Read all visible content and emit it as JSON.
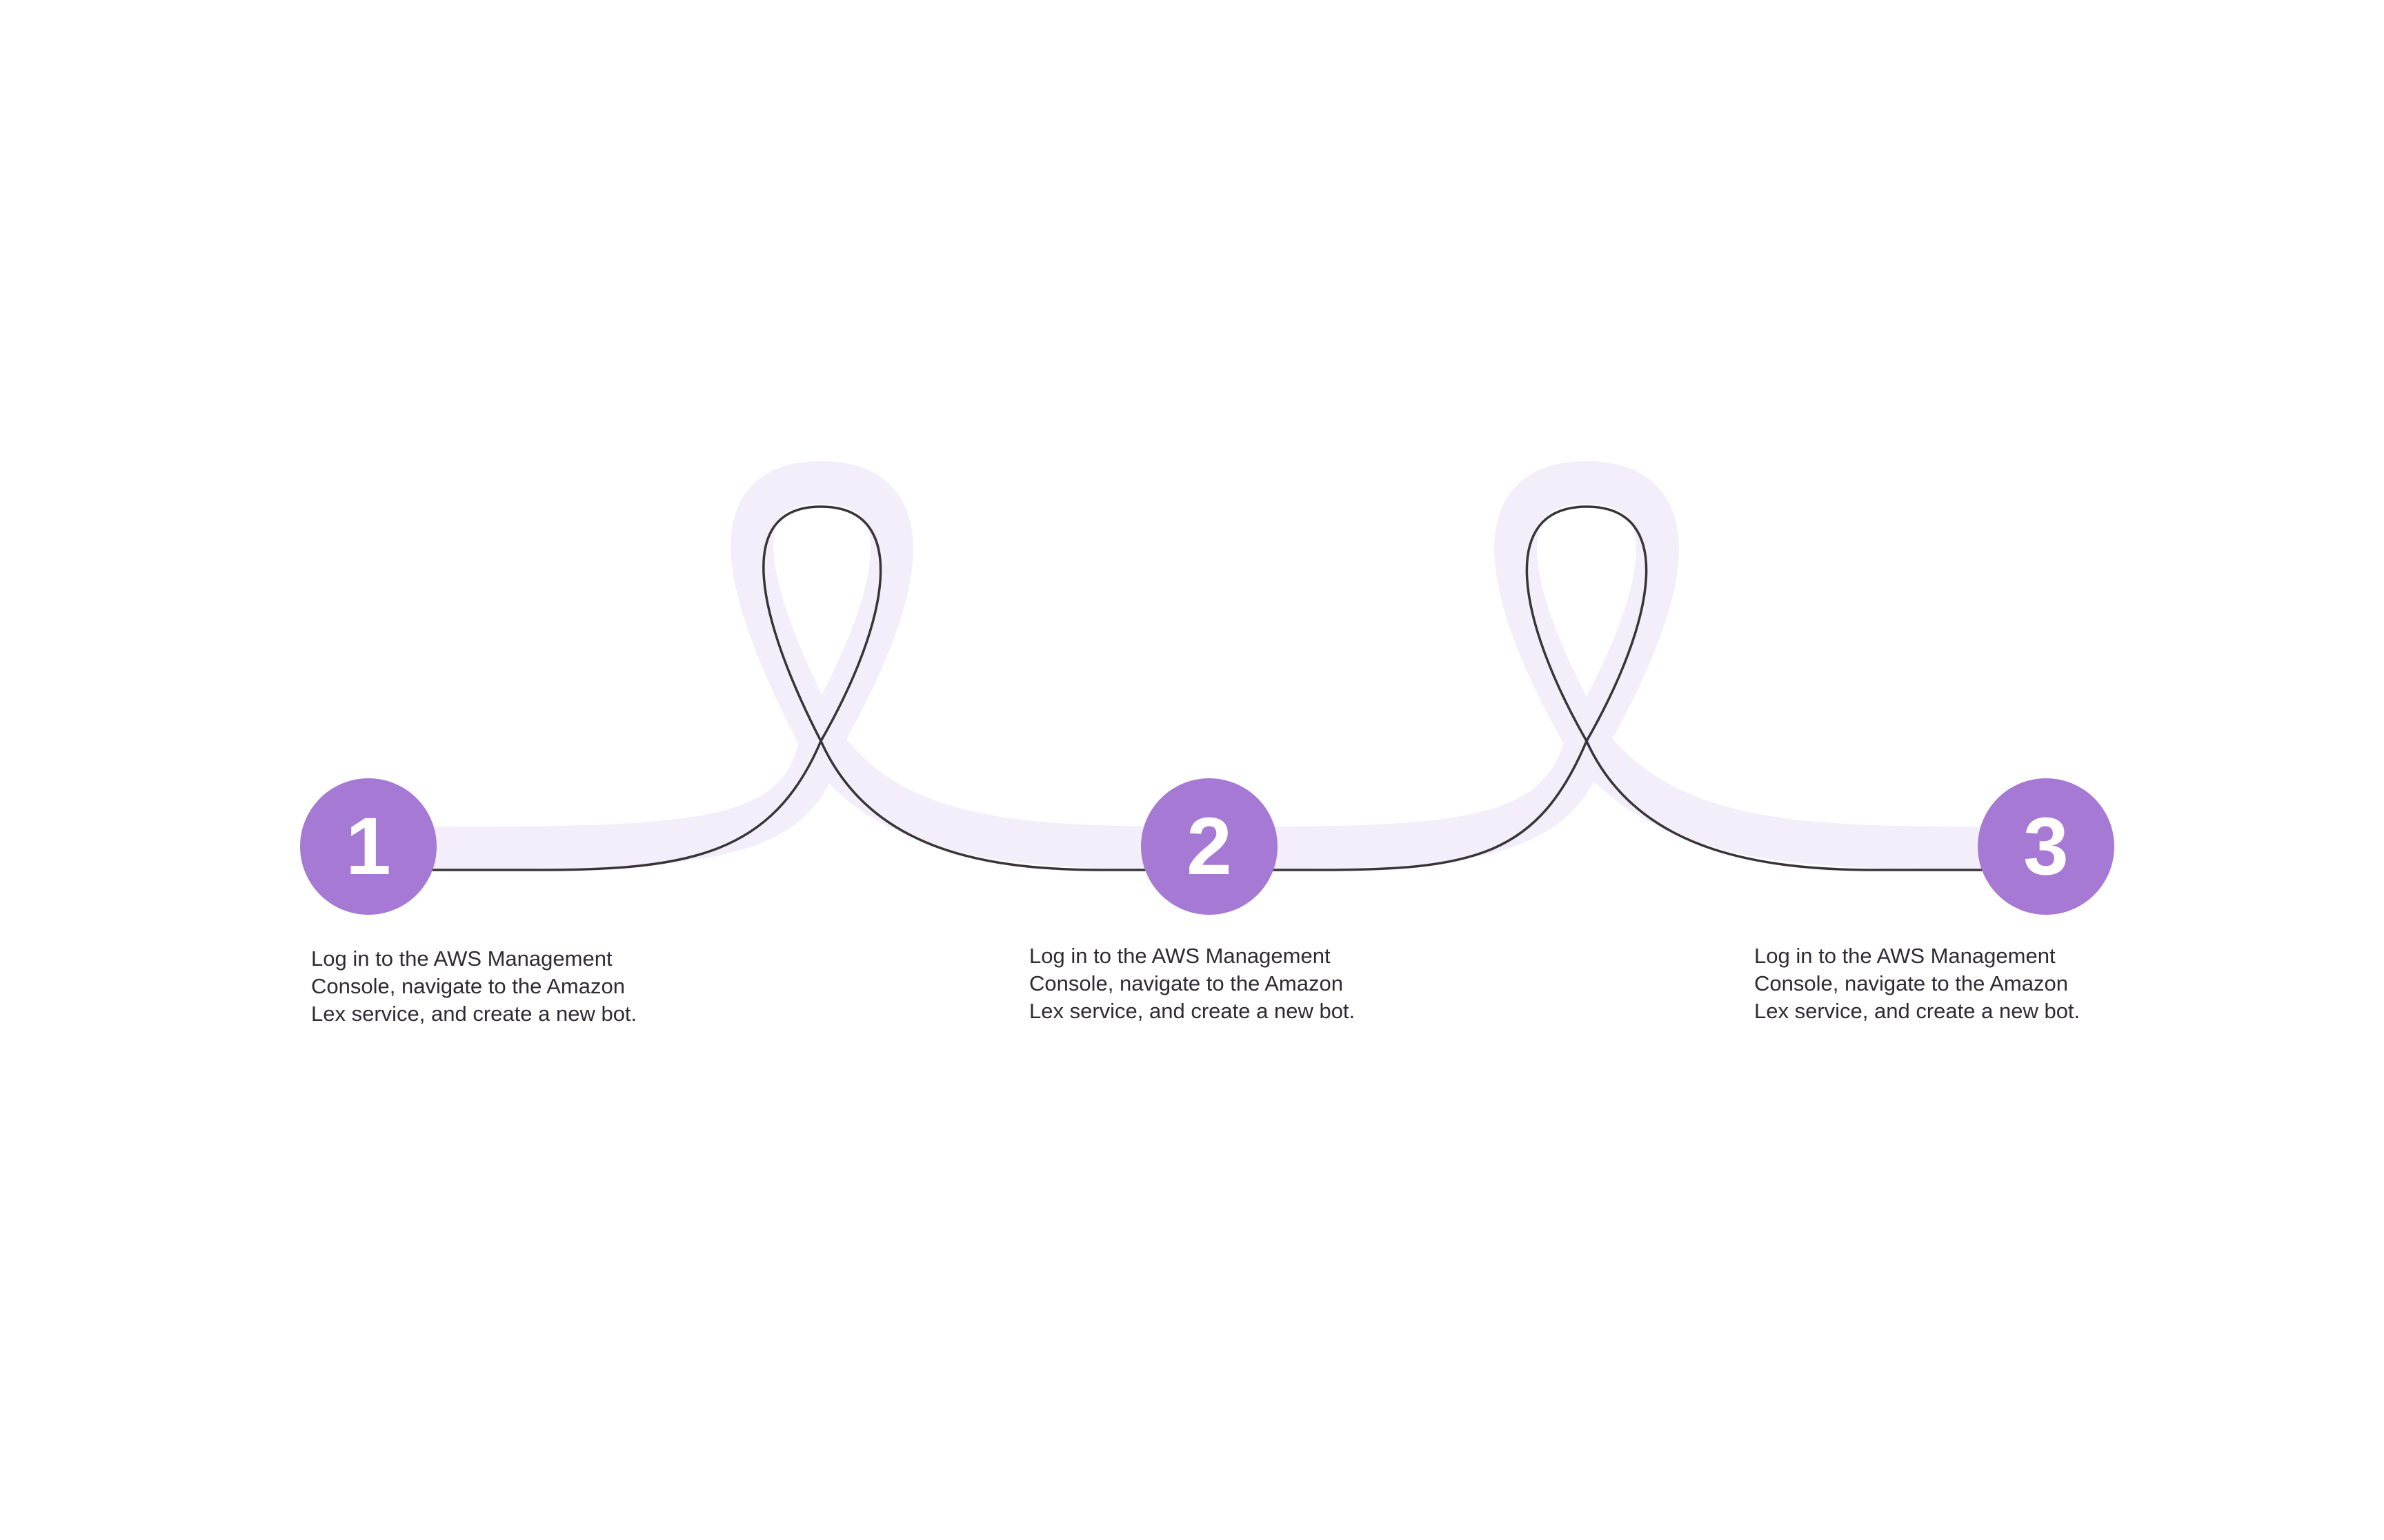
{
  "colors": {
    "accent": "#a67ad4",
    "ribbon": "#f4eefa",
    "line": "#3a3338",
    "number_text": "#ffffff",
    "body_text": "#2f2a33"
  },
  "steps": [
    {
      "number": "1",
      "lines": [
        "Log in to the AWS Management",
        "Console, navigate to the Amazon",
        "Lex service, and create a new bot."
      ]
    },
    {
      "number": "2",
      "lines": [
        "Log in to the AWS Management",
        "Console, navigate to the Amazon",
        "Lex service, and create a new bot."
      ]
    },
    {
      "number": "3",
      "lines": [
        "Log in to the AWS Management",
        "Console, navigate to the Amazon",
        "Lex service, and create a new bot."
      ]
    }
  ]
}
